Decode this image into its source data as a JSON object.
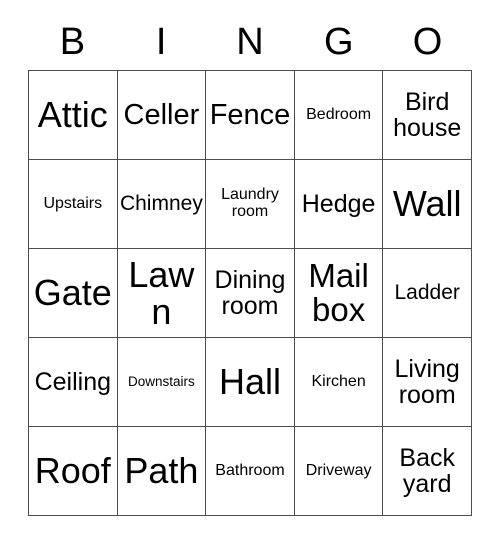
{
  "card": {
    "header_letters": [
      "B",
      "I",
      "N",
      "G",
      "O"
    ],
    "rows": [
      [
        {
          "label": "Attic",
          "size": "xxl"
        },
        {
          "label": "Celler",
          "size": "lg"
        },
        {
          "label": "Fence",
          "size": "lg"
        },
        {
          "label": "Bedroom",
          "size": "xs"
        },
        {
          "label": "Bird\nhouse",
          "size": "md"
        }
      ],
      [
        {
          "label": "Upstairs",
          "size": "xs"
        },
        {
          "label": "Chimney",
          "size": "sm"
        },
        {
          "label": "Laundry\nroom",
          "size": "xs"
        },
        {
          "label": "Hedge",
          "size": "md"
        },
        {
          "label": "Wall",
          "size": "xxl"
        }
      ],
      [
        {
          "label": "Gate",
          "size": "xxl"
        },
        {
          "label": "Lawn",
          "size": "xxl"
        },
        {
          "label": "Dining\nroom",
          "size": "md"
        },
        {
          "label": "Mail\nbox",
          "size": "xl"
        },
        {
          "label": "Ladder",
          "size": "sm"
        }
      ],
      [
        {
          "label": "Ceiling",
          "size": "md"
        },
        {
          "label": "Downstairs",
          "size": "xxs"
        },
        {
          "label": "Hall",
          "size": "xxl"
        },
        {
          "label": "Kirchen",
          "size": "xs"
        },
        {
          "label": "Living\nroom",
          "size": "md"
        }
      ],
      [
        {
          "label": "Roof",
          "size": "xxl"
        },
        {
          "label": "Path",
          "size": "xxl"
        },
        {
          "label": "Bathroom",
          "size": "xs"
        },
        {
          "label": "Driveway",
          "size": "xs"
        },
        {
          "label": "Back\nyard",
          "size": "md"
        }
      ]
    ]
  },
  "colors": {
    "background": "#ffffff",
    "text": "#000000",
    "grid_line": "#4d4d4d"
  }
}
